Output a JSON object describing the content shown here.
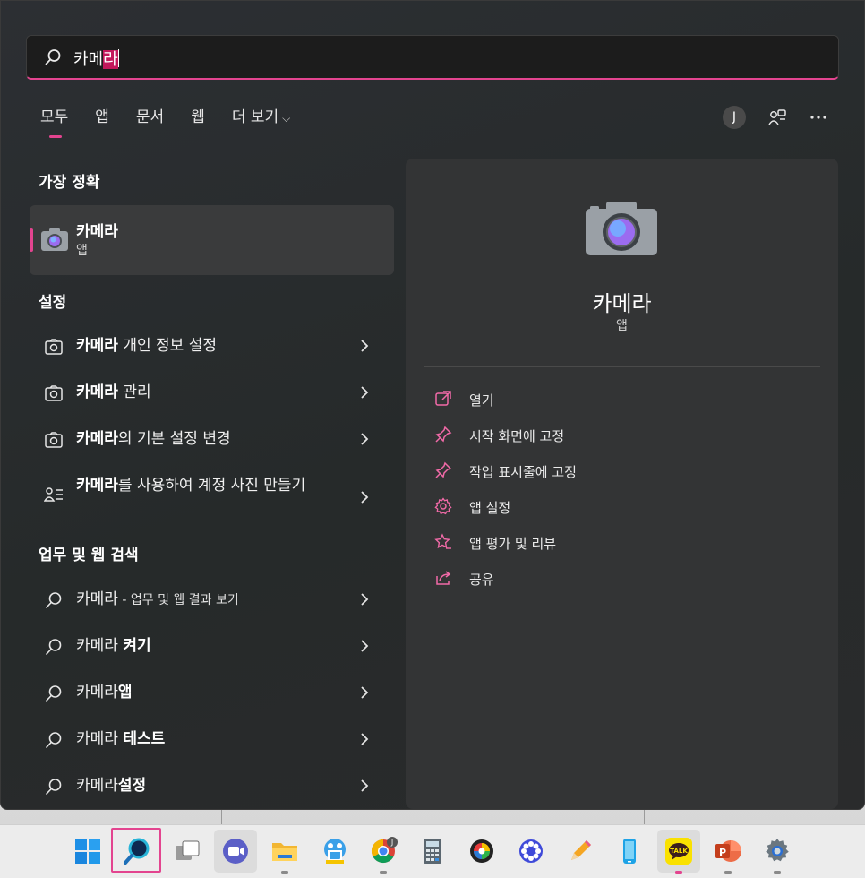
{
  "search": {
    "query_prefix": "카메",
    "query_selected": "라"
  },
  "tabs": [
    {
      "label": "모두",
      "active": true
    },
    {
      "label": "앱"
    },
    {
      "label": "문서"
    },
    {
      "label": "웹"
    },
    {
      "label": "더 보기"
    }
  ],
  "account": {
    "initial": "J"
  },
  "icons": {
    "search": "search-icon",
    "account_switch": "people-switch-icon",
    "more": "more-icon"
  },
  "best_match": {
    "title": "가장 정확",
    "name": "카메라",
    "type": "앱"
  },
  "settings": {
    "title": "설정",
    "items": [
      {
        "bold": "카메라",
        "rest": " 개인 정보 설정"
      },
      {
        "bold": "카메라",
        "rest": " 관리"
      },
      {
        "bold": "카메라",
        "rest": "의 기본 설정 변경"
      },
      {
        "bold": "카메라",
        "rest": "를 사용하여 계정 사진 만들기"
      }
    ]
  },
  "web": {
    "title": "업무 및 웹 검색",
    "items": [
      {
        "plain": "카메라",
        "bold": "",
        "small": " - 업무 및 웹 결과 보기"
      },
      {
        "plain": "카메라 ",
        "bold": "켜기",
        "small": ""
      },
      {
        "plain": "카메라",
        "bold": "앱",
        "small": ""
      },
      {
        "plain": "카메라 ",
        "bold": "테스트",
        "small": ""
      },
      {
        "plain": "카메라",
        "bold": "설정",
        "small": ""
      }
    ]
  },
  "preview": {
    "name": "카메라",
    "type": "앱",
    "actions": [
      {
        "label": "열기",
        "icon": "open-external-icon"
      },
      {
        "label": "시작 화면에 고정",
        "icon": "pin-icon"
      },
      {
        "label": "작업 표시줄에 고정",
        "icon": "pin-icon"
      },
      {
        "label": "앱 설정",
        "icon": "gear-icon"
      },
      {
        "label": "앱 평가 및 리뷰",
        "icon": "star-review-icon"
      },
      {
        "label": "공유",
        "icon": "share-icon"
      }
    ]
  },
  "taskbar": {
    "apps": [
      "start",
      "search",
      "task-view",
      "meet",
      "file-explorer",
      "snipping-tool",
      "chrome",
      "calculator",
      "color-picker",
      "app-blue",
      "pencil",
      "phone",
      "kakaotalk",
      "powerpoint",
      "settings"
    ],
    "chrome_badge": "J",
    "kakao_label": "TALK",
    "ppt_label": "P"
  },
  "colors": {
    "accent": "#e3448f",
    "panel": "#2b2b2b",
    "preview": "#333435"
  }
}
